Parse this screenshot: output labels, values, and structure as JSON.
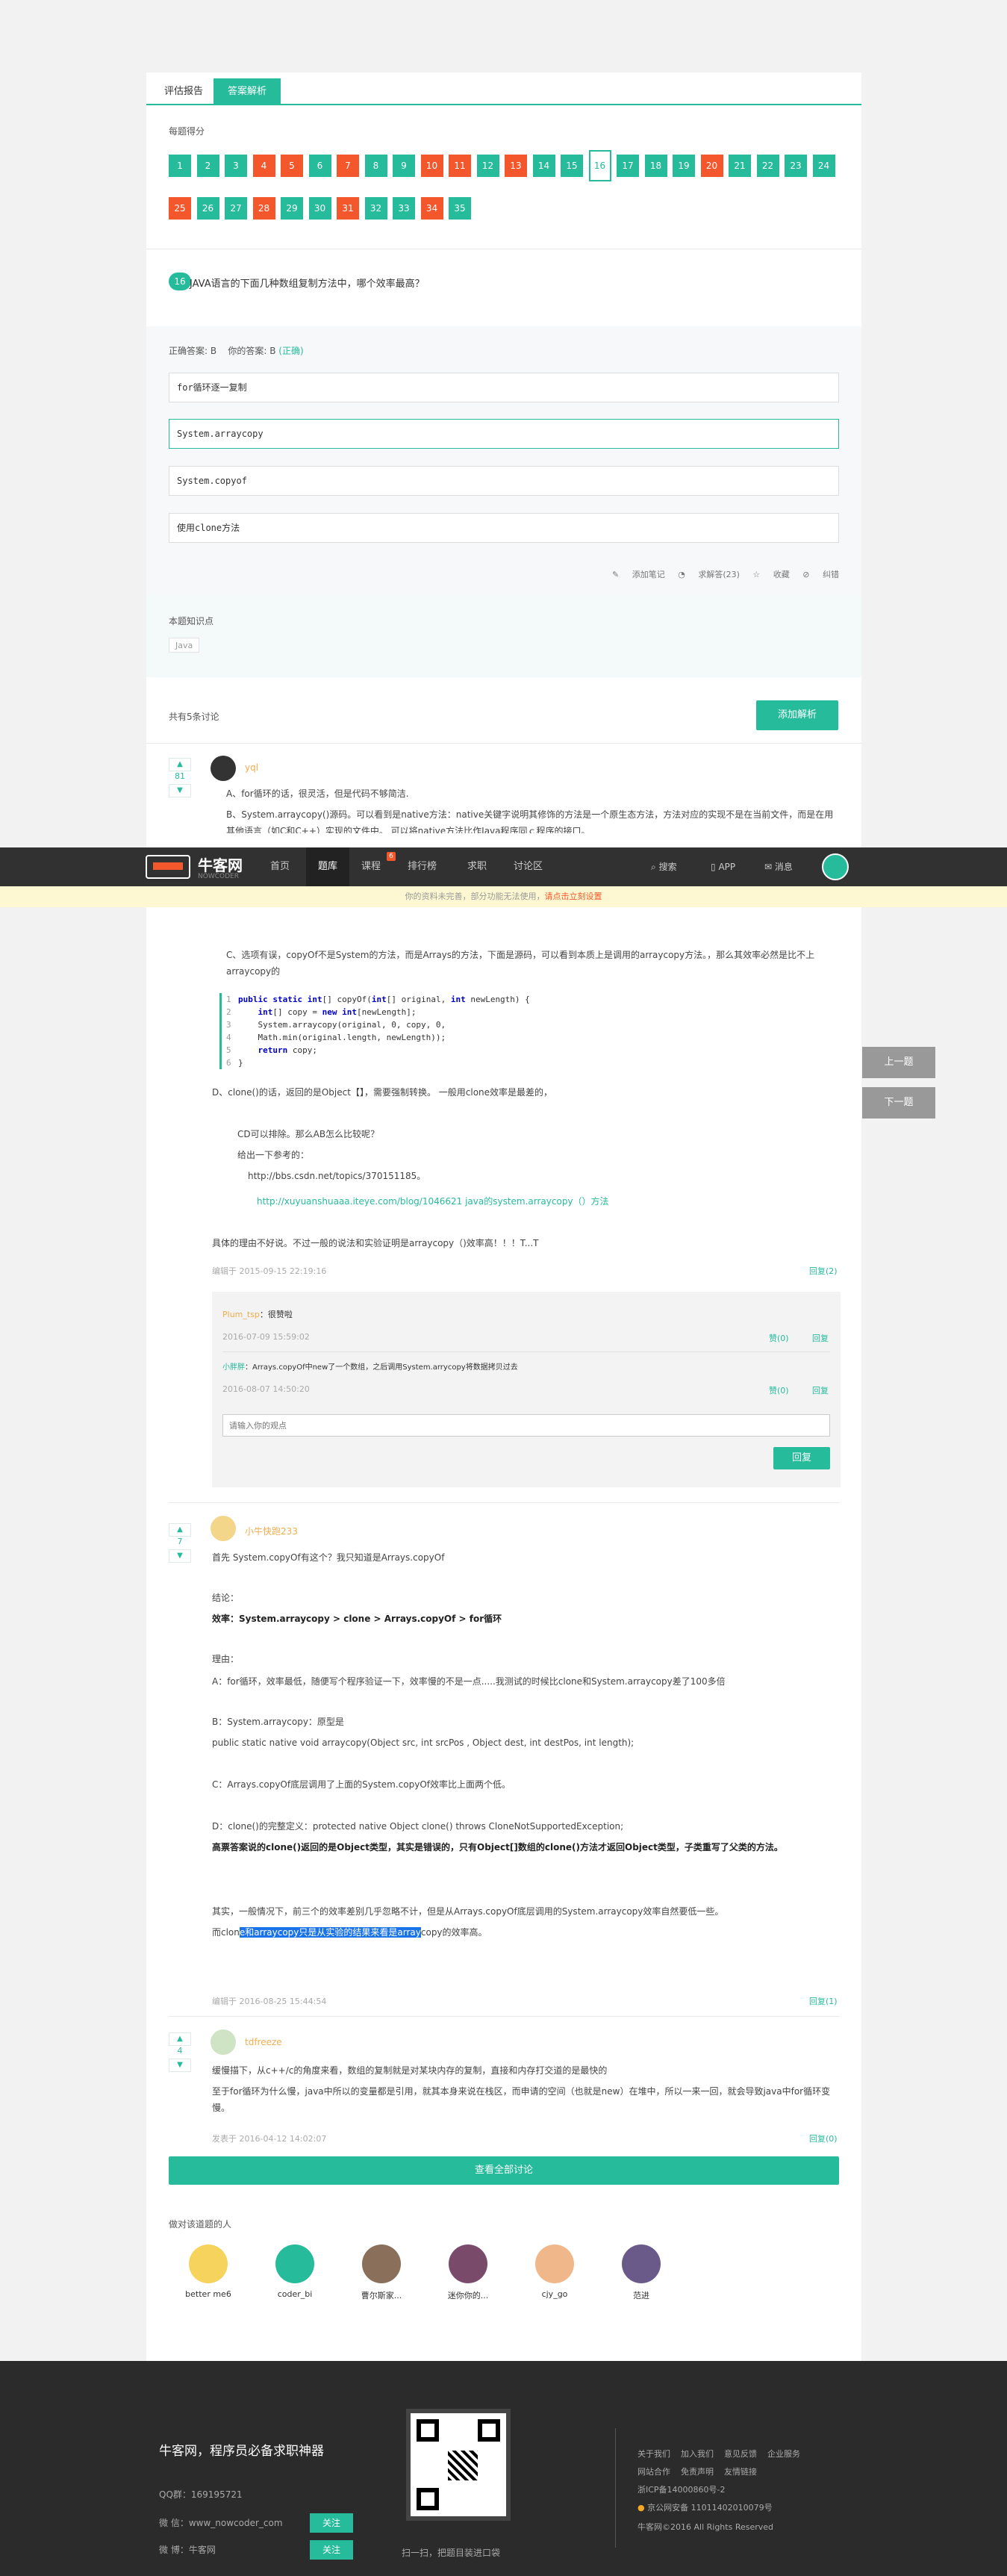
{
  "tabs": [
    "评估报告",
    "答案解析"
  ],
  "score_label": "每题得分",
  "questions": [
    {
      "n": "1",
      "s": "g"
    },
    {
      "n": "2",
      "s": "g"
    },
    {
      "n": "3",
      "s": "g"
    },
    {
      "n": "4",
      "s": "r"
    },
    {
      "n": "5",
      "s": "r"
    },
    {
      "n": "6",
      "s": "g"
    },
    {
      "n": "7",
      "s": "r"
    },
    {
      "n": "8",
      "s": "g"
    },
    {
      "n": "9",
      "s": "g"
    },
    {
      "n": "10",
      "s": "r"
    },
    {
      "n": "11",
      "s": "r"
    },
    {
      "n": "12",
      "s": "g"
    },
    {
      "n": "13",
      "s": "r"
    },
    {
      "n": "14",
      "s": "g"
    },
    {
      "n": "15",
      "s": "g"
    },
    {
      "n": "16",
      "s": "cur"
    },
    {
      "n": "17",
      "s": "g"
    },
    {
      "n": "18",
      "s": "g"
    },
    {
      "n": "19",
      "s": "g"
    },
    {
      "n": "20",
      "s": "r"
    },
    {
      "n": "21",
      "s": "g"
    },
    {
      "n": "22",
      "s": "g"
    },
    {
      "n": "23",
      "s": "g"
    },
    {
      "n": "24",
      "s": "g"
    },
    {
      "n": "25",
      "s": "r"
    },
    {
      "n": "26",
      "s": "g"
    },
    {
      "n": "27",
      "s": "g"
    },
    {
      "n": "28",
      "s": "r"
    },
    {
      "n": "29",
      "s": "g"
    },
    {
      "n": "30",
      "s": "g"
    },
    {
      "n": "31",
      "s": "r"
    },
    {
      "n": "32",
      "s": "g"
    },
    {
      "n": "33",
      "s": "g"
    },
    {
      "n": "34",
      "s": "r"
    },
    {
      "n": "35",
      "s": "g"
    }
  ],
  "question": {
    "num": "16",
    "text": "JAVA语言的下面几种数组复制方法中，哪个效率最高？"
  },
  "answer_line": {
    "correct": "正确答案: B",
    "yours": "你的答案: B",
    "status": "(正确)"
  },
  "options": [
    "for循环逐一复制",
    "System.arraycopy",
    "System.copyof",
    "使用clone方法"
  ],
  "actions": [
    "添加笔记",
    "求解答(23)",
    "收藏",
    "纠错"
  ],
  "knowledge": {
    "label": "本题知识点",
    "tag": "Java"
  },
  "discussions": {
    "count": "共有5条讨论",
    "add_button": "添加解析"
  },
  "nav": {
    "logo": "牛客网",
    "logo_sub": "NOWCODER",
    "items": [
      "首页",
      "题库",
      "课程",
      "排行榜",
      "求职",
      "讨论区"
    ],
    "badge": "6",
    "right": [
      "搜索",
      "APP",
      "消息"
    ]
  },
  "notice": {
    "text": "你的资料未完善，部分功能无法使用，",
    "link": "请点击立刻设置"
  },
  "side": {
    "prev": "上一题",
    "next": "下一题"
  },
  "c1": {
    "votes": "81",
    "user": "yql",
    "a": "A、for循环的话，很灵活，但是代码不够简洁.",
    "b": "B、System.arraycopy()源码。可以看到是native方法：native关键字说明其修饰的方法是一个原生态方法，方法对应的实现不是在当前文件，而是在用其他语言（如C和C++）实现的文件中。 可以将native方法比作Java程序同ｃ程序的接口。",
    "c": "C、选项有误，copyOf不是System的方法，而是Arrays的方法，下面是源码，可以看到本质上是调用的arraycopy方法。，那么其效率必然是比不上 arraycopy的",
    "code": [
      "public static int[] copyOf(int[] original, int newLength) {",
      "    int[] copy = new int[newLength];",
      "    System.arraycopy(original, 0, copy, 0,",
      "    Math.min(original.length, newLength));",
      "    return copy;",
      "}"
    ],
    "d": "D、clone()的话，返回的是Object【】，需要强制转换。 一般用clone效率是最差的，",
    "cd": "CD可以排除。那么AB怎么比较呢？",
    "refs": "给出一下参考的：",
    "url1": "http://bbs.csdn.net/topics/370151185。",
    "url2": "http://xuyuanshuaaa.iteye.com/blog/1046621  java的system.arraycopy（）方法",
    "end": "具体的理由不好说。不过一般的说法和实验证明是arraycopy（)效率高！！！T...T",
    "meta": "编辑于 2015-09-15 22:19:16",
    "reply": "回复(2)",
    "r1_user": "Plum_tsp",
    "r1_text": "：很赞啦",
    "r1_date": "2016-07-09 15:59:02",
    "r1_like": "赞(0)",
    "r1_reply": "回复",
    "r2_user": "小胖胖",
    "r2_text": "：Arrays.copyOf中new了一个数组，之后调用System.arrycopy将数据拷贝过去",
    "r2_date": "2016-08-07 14:50:20",
    "r2_like": "赞(0)",
    "r2_reply": "回复",
    "input_ph": "请输入你的观点",
    "submit": "回复"
  },
  "c2": {
    "votes": "7",
    "user": "小牛快跑233",
    "l1": "首先 System.copyOf有这个？我只知道是Arrays.copyOf",
    "l2": "结论：",
    "l3": "效率：System.arraycopy > clone > Arrays.copyOf > for循环",
    "l4": "理由：",
    "l5": "A：for循环，效率最低，随便写个程序验证一下，效率慢的不是一点.....我测试的时候比clone和System.arraycopy差了100多倍",
    "l6": "B：System.arraycopy：原型是",
    "l7": "public static native void arraycopy(Object src,  int  srcPos , Object dest, int destPos, int length);",
    "l8": "C：Arrays.copyOf底层调用了上面的System.copyOf效率比上面两个低。",
    "l9": "D：clone()的完整定义：protected native Object clone() throws CloneNotSupportedException;",
    "l10": "高票答案说的clone()返回的是Object类型，其实是错误的，只有Object[]数组的clone()方法才返回Object类型，子类重写了父类的方法。",
    "l11": "其实，一般情况下，前三个的效率差别几乎忽略不计，但是从Arrays.copyOf底层调用的System.arraycopy效率自然要低一些。",
    "l12a": "而clon",
    "l12b": "e和arraycopy只是从实验的结果来看是array",
    "l12c": "copy的效率高。",
    "meta": "编辑于 2016-08-25 15:44:54",
    "reply": "回复(1)"
  },
  "c3": {
    "votes": "4",
    "user": "tdfreeze",
    "l1": "缓慢描下，从c++/c的角度来看，数组的复制就是对某块内存的复制，直接和内存打交道的是最快的",
    "l2": "至于for循环为什么慢，java中所以的变量都是引用，就其本身来说在栈区，而申请的空间（也就是new）在堆中，所以一来一回，就会导致java中for循环变慢。",
    "meta": "发表于 2016-04-12 14:02:07",
    "reply": "回复(0)"
  },
  "view_all": "查看全部讨论",
  "people_label": "做对该道题的人",
  "people": [
    "better me6",
    "coder_bi",
    "曹尔斯家...",
    "迷你你的...",
    "cjy_go",
    "范进"
  ],
  "footer": {
    "slogan": "牛客网，程序员必备求职神器",
    "qq": "QQ群：169195721",
    "wx": "微 信：www_nowcoder_com",
    "wb": "微 博：牛客网",
    "follow": "关注",
    "qr": "扫一扫，把题目装进口袋",
    "links1": [
      "关于我们",
      "加入我们",
      "意见反馈",
      "企业服务"
    ],
    "links2": [
      "网站合作",
      "免责声明",
      "友情链接"
    ],
    "icp": "浙ICP备14000860号-2",
    "police": "京公网安备 11011402010079号",
    "copy": "牛客网©2016 All Rights Reserved"
  }
}
